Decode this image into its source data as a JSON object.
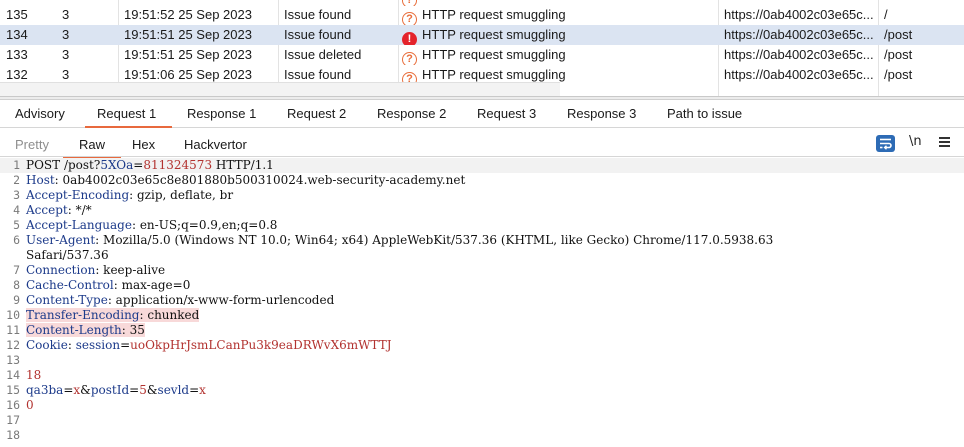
{
  "issues": [
    {
      "num": "",
      "severity": "",
      "time": "",
      "action": "",
      "icon": "question-icon",
      "name": "",
      "host": "",
      "path": ""
    },
    {
      "num": "135",
      "severity": "3",
      "time": "19:51:52 25 Sep 2023",
      "action": "Issue found",
      "icon": "question-icon",
      "name": "HTTP request smuggling",
      "host": "https://0ab4002c03e65c...",
      "path": "/"
    },
    {
      "num": "134",
      "severity": "3",
      "time": "19:51:51 25 Sep 2023",
      "action": "Issue found",
      "icon": "exclamation-icon",
      "name": "HTTP request smuggling",
      "host": "https://0ab4002c03e65c...",
      "path": "/post"
    },
    {
      "num": "133",
      "severity": "3",
      "time": "19:51:51 25 Sep 2023",
      "action": "Issue deleted",
      "icon": "question-icon",
      "name": "HTTP request smuggling",
      "host": "https://0ab4002c03e65c...",
      "path": "/post"
    },
    {
      "num": "132",
      "severity": "3",
      "time": "19:51:06 25 Sep 2023",
      "action": "Issue found",
      "icon": "question-icon",
      "name": "HTTP request smuggling",
      "host": "https://0ab4002c03e65c...",
      "path": "/post"
    }
  ],
  "tabs": [
    "Advisory",
    "Request 1",
    "Response 1",
    "Request 2",
    "Response 2",
    "Request 3",
    "Response 3",
    "Path to issue"
  ],
  "active_tab": "Request 1",
  "subtabs": {
    "pretty": "Pretty",
    "raw": "Raw",
    "hex": "Hex",
    "hackvertor": "Hackvertor"
  },
  "toolbar": {
    "newline_label": "\\n"
  },
  "request": {
    "line1": {
      "method": "POST /post?",
      "param_name": "5XOa",
      "eq": "=",
      "param_value": "811324573",
      "version": " HTTP/1.1"
    },
    "headers": [
      {
        "name": "Host",
        "value": "0ab4002c03e65c8e801880b500310024.web-security-academy.net"
      },
      {
        "name": "Accept-Encoding",
        "value": "gzip, deflate, br"
      },
      {
        "name": "Accept",
        "value": "*/*"
      },
      {
        "name": "Accept-Language",
        "value": "en-US;q=0.9,en;q=0.8"
      },
      {
        "name": "User-Agent",
        "value": "Mozilla/5.0 (Windows NT 10.0; Win64; x64) AppleWebKit/537.36 (KHTML, like Gecko) Chrome/117.0.5938.63",
        "cont": "Safari/537.36"
      },
      {
        "name": "Connection",
        "value": "keep-alive"
      },
      {
        "name": "Cache-Control",
        "value": "max-age=0"
      },
      {
        "name": "Content-Type",
        "value": "application/x-www-form-urlencoded"
      },
      {
        "name": "Transfer-Encoding",
        "value": "chunked"
      },
      {
        "name": "Content-Length",
        "value": "35"
      }
    ],
    "cookie": {
      "name": "Cookie",
      "key": "session",
      "value": "uoOkpHrJsmLCanPu3k9eaDRWvX6mWTTJ"
    },
    "body_chunk_size": "18",
    "body_params": [
      {
        "key": "qa3ba",
        "value": "x"
      },
      {
        "key": "postId",
        "value": "5"
      },
      {
        "key": "sevld",
        "value": "x"
      }
    ],
    "terminator": "0",
    "line_numbers": [
      "1",
      "2",
      "3",
      "4",
      "5",
      "6",
      "",
      "7",
      "8",
      "9",
      "10",
      "11",
      "12",
      "13",
      "14",
      "15",
      "16",
      "17",
      "18"
    ]
  }
}
